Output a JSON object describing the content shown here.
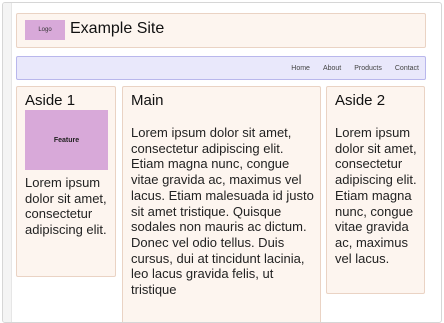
{
  "header": {
    "logo_text": "Logo",
    "site_title": "Example Site"
  },
  "nav": {
    "items": [
      "Home",
      "About",
      "Products",
      "Contact"
    ]
  },
  "aside1": {
    "title": "Aside 1",
    "feature_label": "Feature",
    "text": "Lorem ipsum dolor sit amet, consectetur adipiscing elit."
  },
  "main": {
    "title": "Main",
    "text": "Lorem ipsum dolor sit amet, consectetur adipiscing elit. Etiam magna nunc, congue vitae gravida ac, maximus vel lacus. Etiam malesuada id justo sit amet tristique. Quisque sodales non mauris ac dictum. Donec vel odio tellus. Duis cursus, dui at tincidunt lacinia, leo lacus gravida felis, ut tristique"
  },
  "aside2": {
    "title": "Aside 2",
    "text": "Lorem ipsum dolor sit amet, consectetur adipiscing elit. Etiam magna nunc, congue vitae gravida ac, maximus vel lacus."
  },
  "colors": {
    "panel_bg": "#fdf5ef",
    "panel_border": "#ead3c4",
    "nav_bg": "#e9e8fb",
    "nav_border": "#b9b7ec",
    "logo_bg": "#d8a9d9"
  }
}
